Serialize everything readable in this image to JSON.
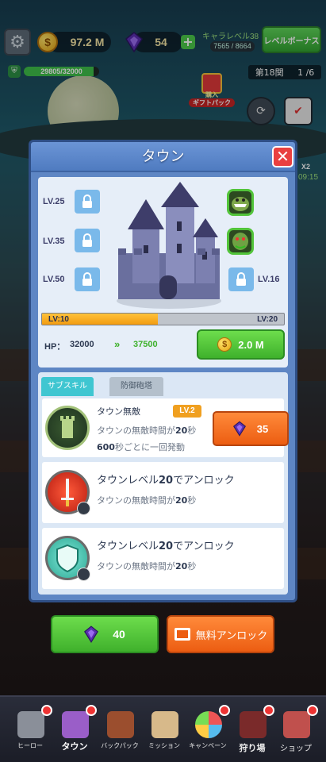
{
  "hud": {
    "coins": "97.2 M",
    "gems": "54",
    "char_level_label": "キャラレベル38",
    "char_exp": "7565 / 8664",
    "level_bonus_label": "レベルボーナス",
    "base_hp": "29805/32000",
    "base_hp_fraction": 0.93,
    "stage_label": "第18関",
    "wave": "1 /6",
    "gift_pack_top": "購入",
    "gift_pack_bottom": "ギフトパック",
    "side_timer_fragment": "09:15",
    "side_x2": "X2"
  },
  "modal": {
    "title": "タウン",
    "unlocks": [
      {
        "level": "LV.25"
      },
      {
        "level": "LV.35"
      },
      {
        "level": "LV.50"
      },
      {
        "level": "LV.16"
      }
    ],
    "progress": {
      "current": "LV:10",
      "next": "LV:20",
      "fraction": 0.48
    },
    "hp_label": "HP：",
    "hp_current": "32000",
    "hp_next": "37500",
    "upgrade_cost": "2.0 M",
    "tabs": [
      {
        "label": "サブスキル",
        "active": true
      },
      {
        "label": "防御砲塔",
        "active": false
      }
    ],
    "skills": [
      {
        "title": "タウン無敵",
        "level_tag": "LV.2",
        "desc1_pre": "タウンの無敵時間が",
        "desc1_num": "20",
        "desc1_post": "秒",
        "desc2_num": "600",
        "desc2_post": "秒ごとに一回発動",
        "cost": "35"
      },
      {
        "title_pre": "タウンレベル",
        "title_num": "20",
        "title_post": "でアンロック",
        "desc_pre": "タウンの無敵時間が",
        "desc_num": "20",
        "desc_post": "秒"
      },
      {
        "title_pre": "タウンレベル",
        "title_num": "20",
        "title_post": "でアンロック",
        "desc_pre": "タウンの無敵時間が",
        "desc_num": "20",
        "desc_post": "秒"
      }
    ]
  },
  "bottom_buttons": {
    "gem_cost": "40",
    "free_unlock_label": "無料アンロック"
  },
  "nav": [
    {
      "label": "ヒーロー",
      "icon": "knight-helmet-icon"
    },
    {
      "label": "タウン",
      "icon": "castle-icon"
    },
    {
      "label": "バックパック",
      "icon": "backpack-icon"
    },
    {
      "label": "ミッション",
      "icon": "scroll-icon"
    },
    {
      "label": "キャンペーン",
      "icon": "wheel-icon"
    },
    {
      "label": "狩り場",
      "icon": "skull-icon"
    },
    {
      "label": "ショップ",
      "icon": "shop-icon"
    }
  ],
  "colors": {
    "accent_green": "#3fb12c",
    "accent_orange": "#ec5d12",
    "modal_blue": "#5e86c4",
    "tab_active": "#3fc6d1"
  }
}
